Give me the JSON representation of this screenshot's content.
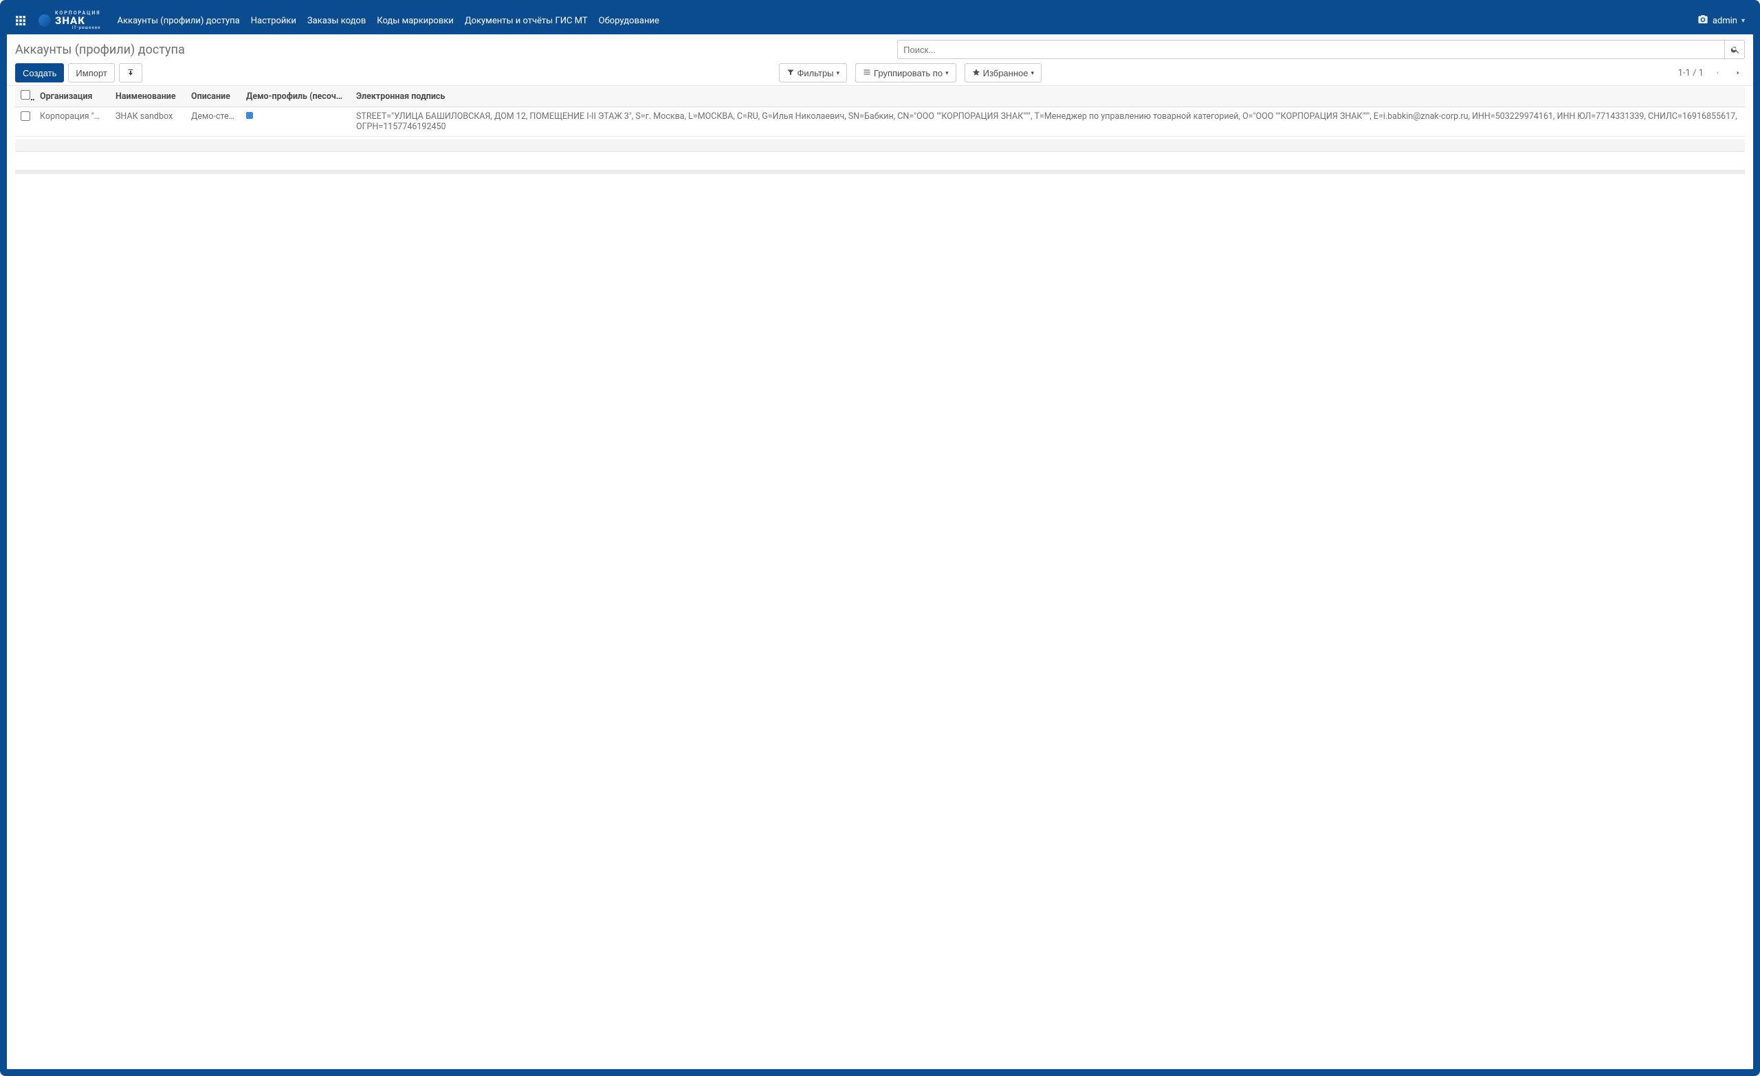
{
  "brand": {
    "small": "КОРПОРАЦИЯ",
    "main": "ЗНАК",
    "sub": "IT-решения"
  },
  "nav": {
    "items": [
      "Аккаунты (профили) доступа",
      "Настройки",
      "Заказы кодов",
      "Коды маркировки",
      "Документы и отчёты ГИС МТ",
      "Оборудование"
    ]
  },
  "user": {
    "name": "admin"
  },
  "page": {
    "title": "Аккаунты (профили) доступа",
    "create": "Создать",
    "import": "Импорт"
  },
  "search": {
    "placeholder": "Поиск..."
  },
  "filters": {
    "filter": "Фильтры",
    "group_by": "Группировать по",
    "favorites": "Избранное"
  },
  "pager": {
    "range": "1-1 / 1"
  },
  "table": {
    "headers": {
      "org": "Организация",
      "name": "Наименование",
      "desc": "Описание",
      "demo": "Демо-профиль (песочница...",
      "sig": "Электронная подпись"
    },
    "rows": [
      {
        "org": "Корпорация \"Зн...",
        "name": "ЗНАК sandbox",
        "desc": "Демо-стенд",
        "demo_checked": true,
        "sig": "STREET=\"УЛИЦА БАШИЛОВСКАЯ, ДОМ 12, ПОМЕЩЕНИЕ I-II ЭТАЖ 3\", S=г. Москва, L=МОСКВА, C=RU, G=Илья Николаевич, SN=Бабкин, CN=\"ООО \"\"КОРПОРАЦИЯ ЗНАК\"\"\", T=Менеджер по управлению товарной категорией, O=\"ООО \"\"КОРПОРАЦИЯ ЗНАК\"\"\", E=i.babkin@znak-corp.ru, ИНН=503229974161, ИНН ЮЛ=7714331339, СНИЛС=16916855617, ОГРН=1157746192450"
      }
    ]
  }
}
